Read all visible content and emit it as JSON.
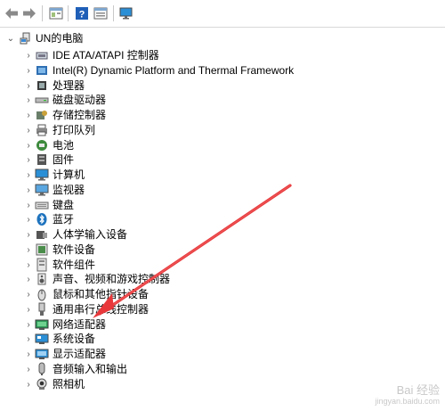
{
  "toolbar": {
    "buttons": [
      {
        "icon": "back-arrow-icon"
      },
      {
        "icon": "forward-arrow-icon"
      },
      {
        "icon": "properties-panel-icon"
      },
      {
        "icon": "help-icon"
      },
      {
        "icon": "details-pane-icon"
      },
      {
        "icon": "monitor-scan-icon"
      }
    ]
  },
  "tree": {
    "root": {
      "label": "UN的电脑",
      "expanded": true
    },
    "items": [
      {
        "label": "IDE ATA/ATAPI 控制器",
        "icon": "ide-controller-icon"
      },
      {
        "label": "Intel(R) Dynamic Platform and Thermal Framework",
        "icon": "intel-platform-icon"
      },
      {
        "label": "处理器",
        "icon": "processor-icon"
      },
      {
        "label": "磁盘驱动器",
        "icon": "disk-drive-icon"
      },
      {
        "label": "存储控制器",
        "icon": "storage-controller-icon"
      },
      {
        "label": "打印队列",
        "icon": "printer-icon"
      },
      {
        "label": "电池",
        "icon": "battery-icon"
      },
      {
        "label": "固件",
        "icon": "firmware-icon"
      },
      {
        "label": "计算机",
        "icon": "computer-icon"
      },
      {
        "label": "监视器",
        "icon": "monitor-icon"
      },
      {
        "label": "键盘",
        "icon": "keyboard-icon"
      },
      {
        "label": "蓝牙",
        "icon": "bluetooth-icon"
      },
      {
        "label": "人体学输入设备",
        "icon": "hid-icon"
      },
      {
        "label": "软件设备",
        "icon": "software-device-icon"
      },
      {
        "label": "软件组件",
        "icon": "software-component-icon"
      },
      {
        "label": "声音、视频和游戏控制器",
        "icon": "sound-icon"
      },
      {
        "label": "鼠标和其他指针设备",
        "icon": "mouse-icon"
      },
      {
        "label": "通用串行总线控制器",
        "icon": "usb-icon"
      },
      {
        "label": "网络适配器",
        "icon": "network-adapter-icon"
      },
      {
        "label": "系统设备",
        "icon": "system-device-icon"
      },
      {
        "label": "显示适配器",
        "icon": "display-adapter-icon"
      },
      {
        "label": "音频输入和输出",
        "icon": "audio-io-icon"
      },
      {
        "label": "照相机",
        "icon": "camera-icon"
      }
    ]
  },
  "watermark": {
    "line1": "Bai 经验",
    "line2": "jingyan.baidu.com"
  },
  "colors": {
    "annotation_arrow": "#e8383b",
    "accent": "#1e73be"
  }
}
